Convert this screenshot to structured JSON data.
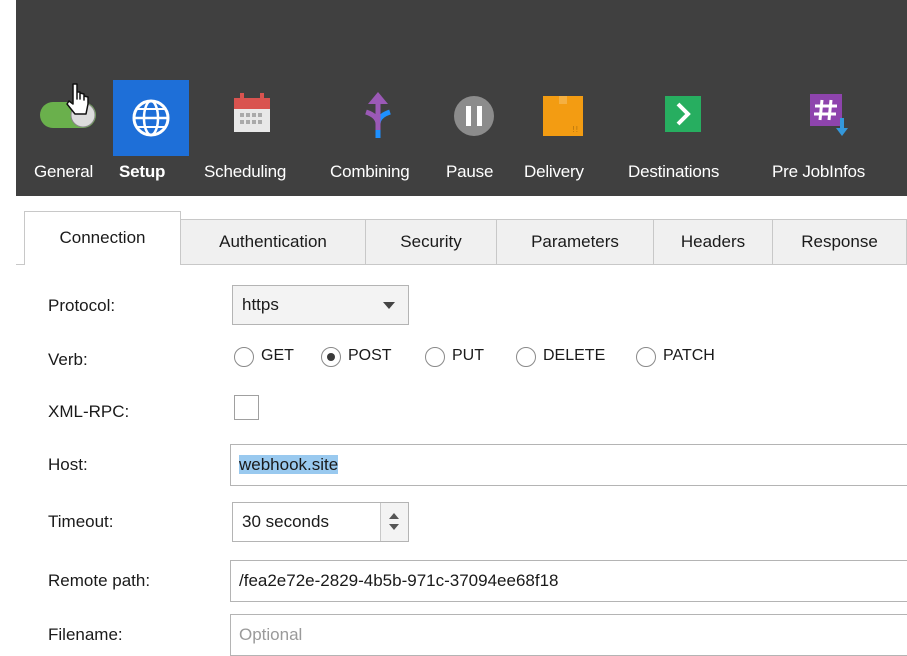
{
  "toolbar": {
    "items": [
      {
        "label": "General",
        "icon": "toggle-icon"
      },
      {
        "label": "Setup",
        "icon": "globe-icon"
      },
      {
        "label": "Scheduling",
        "icon": "calendar-icon"
      },
      {
        "label": "Combining",
        "icon": "merge-arrow-icon"
      },
      {
        "label": "Pause",
        "icon": "pause-icon"
      },
      {
        "label": "Delivery",
        "icon": "package-icon"
      },
      {
        "label": "Destinations",
        "icon": "chevron-right-icon"
      },
      {
        "label": "Pre JobInfos",
        "icon": "hash-icon"
      }
    ],
    "active": "Setup"
  },
  "tabs": [
    {
      "label": "Connection"
    },
    {
      "label": "Authentication"
    },
    {
      "label": "Security"
    },
    {
      "label": "Parameters"
    },
    {
      "label": "Headers"
    },
    {
      "label": "Response"
    }
  ],
  "selected_tab": "Connection",
  "form": {
    "protocol": {
      "label": "Protocol:",
      "value": "https"
    },
    "verb": {
      "label": "Verb:",
      "options": [
        "GET",
        "POST",
        "PUT",
        "DELETE",
        "PATCH"
      ],
      "selected": "POST"
    },
    "xmlrpc": {
      "label": "XML-RPC:",
      "checked": false
    },
    "host": {
      "label": "Host:",
      "value": "webhook.site"
    },
    "timeout": {
      "label": "Timeout:",
      "value": "30 seconds"
    },
    "remote_path": {
      "label": "Remote path:",
      "value": "/fea2e72e-2829-4b5b-971c-37094ee68f18"
    },
    "filename": {
      "label": "Filename:",
      "placeholder": "Optional"
    }
  },
  "colors": {
    "toolbar_bg": "#404040",
    "active_tool_bg": "#1e6fd8",
    "host_selection": "#99c9ef"
  }
}
